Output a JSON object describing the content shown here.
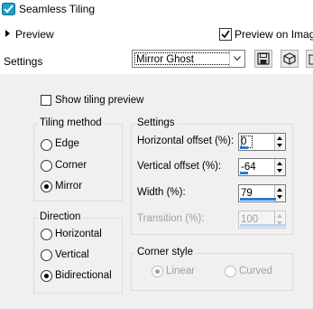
{
  "window": {
    "title": "Seamless Tiling"
  },
  "preview": {
    "label": "Preview",
    "on_image_label": "Preview on Image",
    "on_image_checked": true
  },
  "settings_row": {
    "label": "Settings",
    "preset_value": "Mirror Ghost"
  },
  "show_tiling_preview": {
    "label": "Show tiling preview",
    "checked": false
  },
  "tiling_method": {
    "title": "Tiling method",
    "options": [
      {
        "label": "Edge",
        "selected": false
      },
      {
        "label": "Corner",
        "selected": false
      },
      {
        "label": "Mirror",
        "selected": true
      }
    ]
  },
  "direction": {
    "title": "Direction",
    "options": [
      {
        "label": "Horizontal",
        "selected": false
      },
      {
        "label": "Vertical",
        "selected": false
      },
      {
        "label": "Bidirectional",
        "selected": true
      }
    ]
  },
  "settings_group": {
    "title": "Settings",
    "horizontal_offset": {
      "label": "Horizontal offset (%):",
      "value": "0",
      "level": 0.0
    },
    "vertical_offset": {
      "label": "Vertical offset (%):",
      "value": "-64",
      "level": 0.18
    },
    "width": {
      "label": "Width (%):",
      "value": "79",
      "level": 0.79
    },
    "transition": {
      "label": "Transition (%):",
      "value": "100",
      "level": 1.0,
      "enabled": false
    }
  },
  "corner_style": {
    "title": "Corner style",
    "options": [
      {
        "label": "Linear",
        "selected": true,
        "enabled": false
      },
      {
        "label": "Curved",
        "selected": false,
        "enabled": false
      }
    ]
  },
  "colors": {
    "accent": "#2b7bd6",
    "panel": "#f0f0f0",
    "disabled_text": "#a0a0a0"
  },
  "icons": [
    "seamless-tiling-app-icon",
    "expand-arrow-icon",
    "checkmark-icon",
    "dropdown-arrow-icon",
    "save-icon",
    "cube-icon",
    "delete-icon"
  ]
}
